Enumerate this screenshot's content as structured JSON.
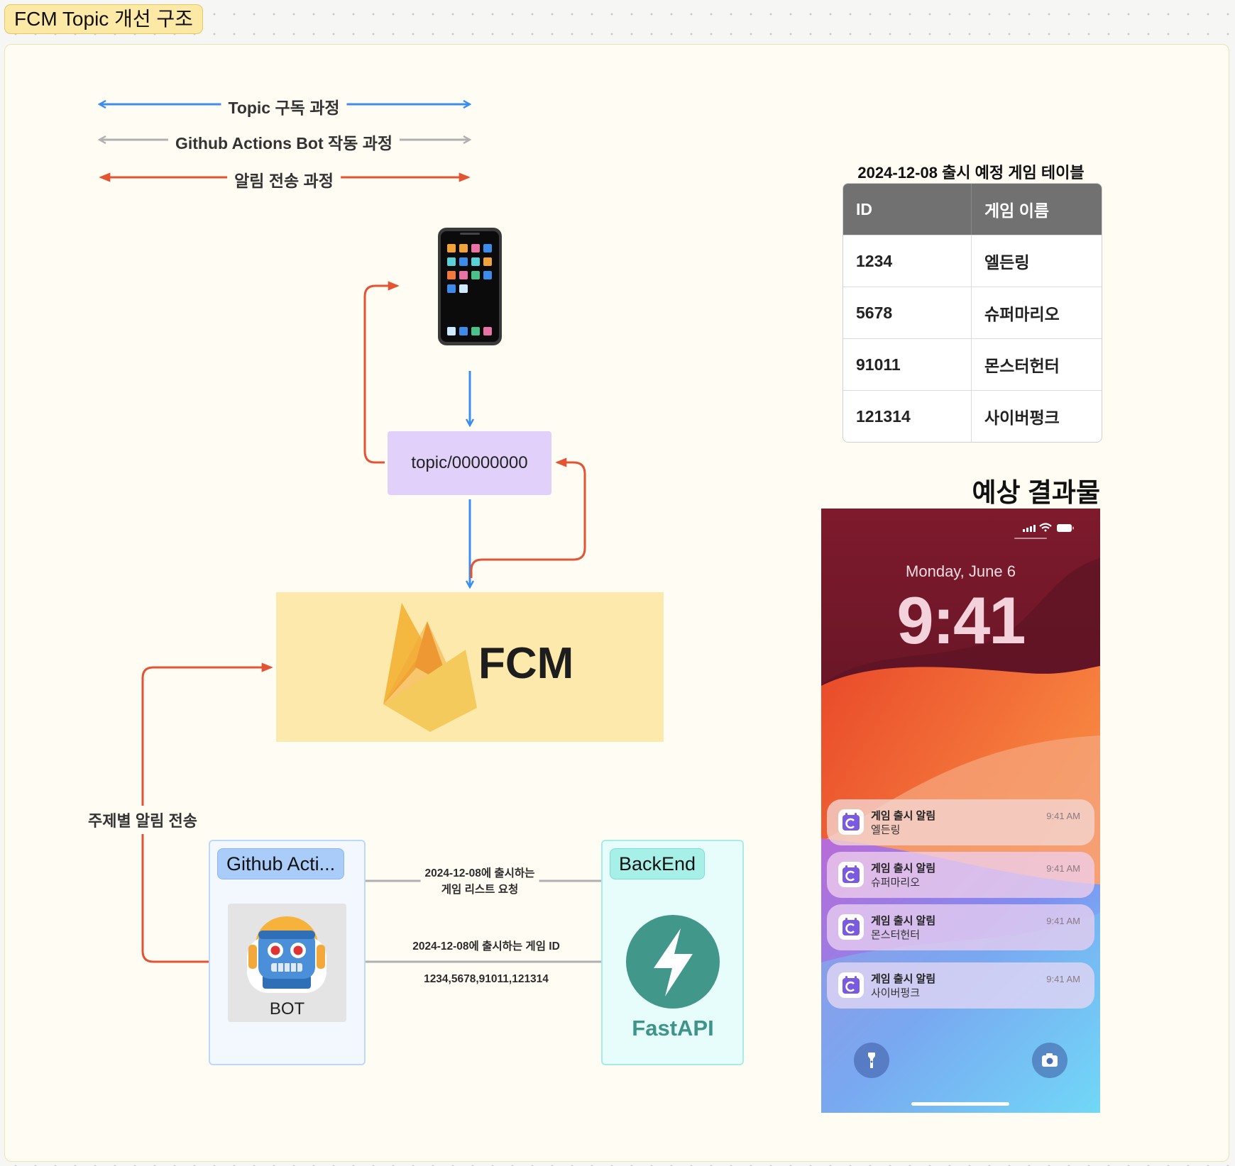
{
  "frame": {
    "title": "FCM Topic 개선 구조"
  },
  "legend": {
    "subscribe": "Topic 구독 과정",
    "bot": "Github Actions Bot 작동 과정",
    "notify": "알림 전송 과정"
  },
  "colors": {
    "subscribe": "#3b8ef0",
    "bot": "#b0b0b0",
    "notify": "#e25433"
  },
  "topic_box": {
    "label": "topic/00000000"
  },
  "fcm": {
    "label": "FCM"
  },
  "edge_labels": {
    "topic_notify": "주제별 알림 전송",
    "request_line1": "2024-12-08에 출시하는",
    "request_line2": "게임 리스트 요청",
    "response_line1": "2024-12-08에 출시하는 게임 ID",
    "response_line2": "1234,5678,91011,121314"
  },
  "github_group": {
    "tag": "Github Acti...",
    "bot_label": "BOT"
  },
  "backend_group": {
    "tag": "BackEnd",
    "app_label": "FastAPI"
  },
  "table": {
    "title": "2024-12-08 출시 예정 게임 테이블",
    "headers": [
      "ID",
      "게임 이름"
    ],
    "rows": [
      [
        "1234",
        "엘든링"
      ],
      [
        "5678",
        "슈퍼마리오"
      ],
      [
        "91011",
        "몬스터헌터"
      ],
      [
        "121314",
        "사이버펑크"
      ]
    ]
  },
  "result": {
    "title": "예상 결과물",
    "date": "Monday, June 6",
    "time": "9:41",
    "notifications": [
      {
        "title": "게임 출시 알림",
        "body": "엘든링",
        "time": "9:41 AM"
      },
      {
        "title": "게임 출시 알림",
        "body": "슈퍼마리오",
        "time": "9:41 AM"
      },
      {
        "title": "게임 출시 알림",
        "body": "몬스터헌터",
        "time": "9:41 AM"
      },
      {
        "title": "게임 출시 알림",
        "body": "사이버펑크",
        "time": "9:41 AM"
      }
    ],
    "icons": [
      "signal-icon",
      "wifi-icon",
      "battery-icon",
      "flashlight-icon",
      "camera-icon"
    ]
  }
}
